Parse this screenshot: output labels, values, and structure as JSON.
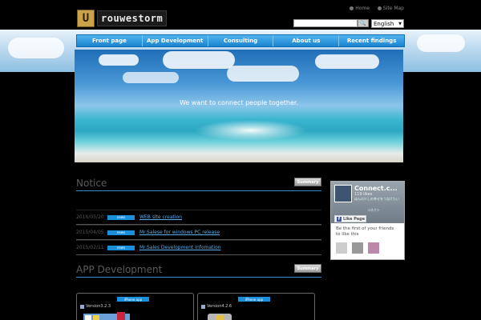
{
  "header": {
    "logo_text": "rouwestorm",
    "toplinks": [
      "Home",
      "Site Map"
    ],
    "search_placeholder": "",
    "search_button": "🔍",
    "language": "English"
  },
  "nav": {
    "tabs": [
      "Front page",
      "App Development",
      "Consulting",
      "About us",
      "Recent findings"
    ]
  },
  "hero": {
    "tagline": "We want to connect people together."
  },
  "notice": {
    "title": "Notice",
    "summary_label": "Summary",
    "items": [
      {
        "date": "2016/05/20",
        "badge": "news",
        "text": "WEB site creation"
      },
      {
        "date": "2015/04/05",
        "badge": "news",
        "text": "Mr.Salese for windows PC release"
      },
      {
        "date": "2015/02/11",
        "badge": "news",
        "text": "Mr.Sales Development Infomation"
      }
    ]
  },
  "apps": {
    "title": "APP Development",
    "summary_label": "Summary",
    "cards": [
      {
        "type": "iPhone app",
        "version": "Version3.2.3"
      },
      {
        "type": "iPhone app",
        "version": "Version4.2.6"
      }
    ]
  },
  "facebook": {
    "page_name": "Connect.c...",
    "likes": "119 likes",
    "sub": "ほんの少しの幸せをつなげたい",
    "mini": "コネクト",
    "like_button": "Like Page",
    "friends_text": "Be the first of your friends to like this"
  }
}
